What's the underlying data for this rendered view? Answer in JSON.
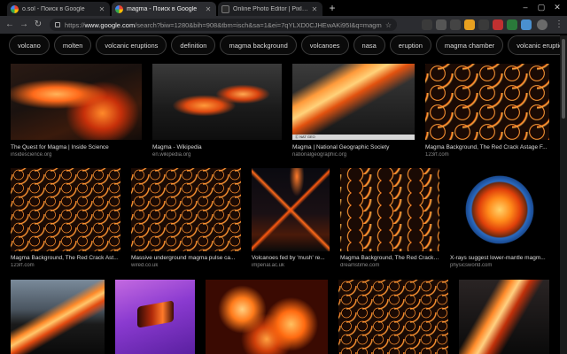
{
  "tabs": [
    {
      "label": "o.sol - Поиск в Google",
      "icon": "google-icon",
      "active": false
    },
    {
      "label": "magma - Поиск в Google",
      "icon": "google-icon",
      "active": true
    },
    {
      "label": "Online Photo Editor | Pixlr Editor",
      "icon": "pixlr-icon",
      "active": false
    }
  ],
  "newtab_glyph": "+",
  "window": {
    "minimize": "–",
    "maximize": "▢",
    "close": "✕"
  },
  "nav": {
    "back": "←",
    "forward": "→",
    "reload": "↻"
  },
  "omnibox": {
    "prefix": "https://",
    "host": "www.google.com",
    "rest": "/search?biw=1280&bih=908&tbm=isch&sa=1&ei=7qYLXD0CJHEwAKi95I&q=magma&oq=magma"
  },
  "menu_glyph": "⋮",
  "chips": [
    "volcano",
    "molten",
    "volcanic eruptions",
    "definition",
    "magma background",
    "volcanoes",
    "nasa",
    "eruption",
    "magma chamber",
    "volcanic eruption"
  ],
  "results": [
    {
      "caption": "The Quest for Magma | Inside Science",
      "source": "insidescience.org"
    },
    {
      "caption": "Magma - Wikipedia",
      "source": "en.wikipedia.org"
    },
    {
      "caption": "Magma | National Geographic Society",
      "source": "nationalgeographic.org"
    },
    {
      "caption": "Magma Background, The Red Crack Astage F...",
      "source": "123rf.com"
    },
    {
      "caption": "Magma Background, The Red Crack Ast...",
      "source": "123rf.com"
    },
    {
      "caption": "Massive underground magma pulse ca...",
      "source": "wired.co.uk"
    },
    {
      "caption": "Volcanoes fed by 'mush' re...",
      "source": "imperial.ac.uk"
    },
    {
      "caption": "Magma Background, The Red Crack Ast...",
      "source": "dreamstime.com"
    },
    {
      "caption": "X-rays suggest lower-mantle magm...",
      "source": "physicsworld.com"
    },
    {
      "caption": "",
      "source": ""
    },
    {
      "caption": "",
      "source": ""
    },
    {
      "caption": "",
      "source": ""
    },
    {
      "caption": "",
      "source": ""
    },
    {
      "caption": "",
      "source": ""
    }
  ],
  "ngs_watermark": "Ⓒ NAT GEO",
  "colors": {
    "accent": "#8ab4f8",
    "lava": "#ff6a1a",
    "background": "#000000"
  }
}
